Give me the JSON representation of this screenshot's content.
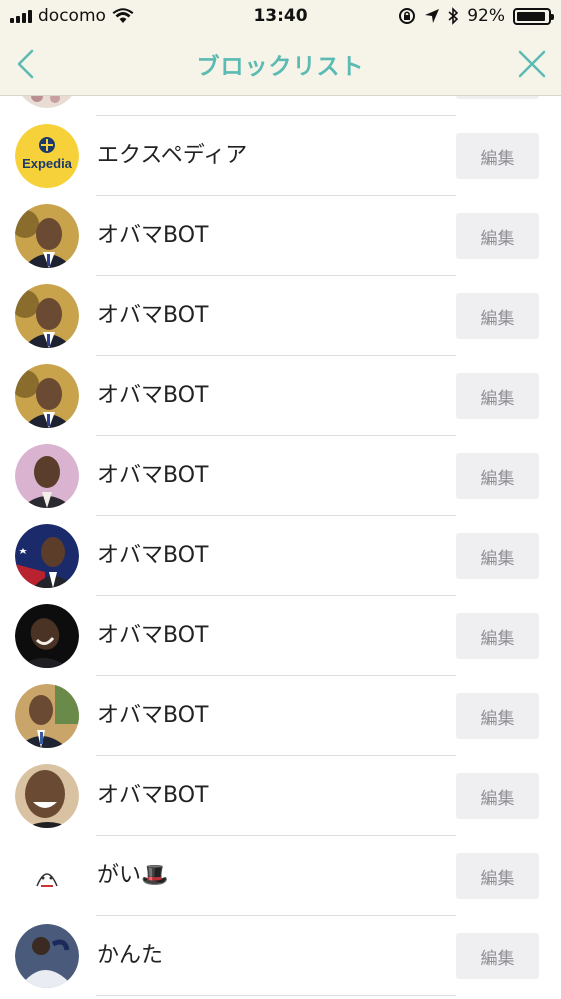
{
  "status_bar": {
    "carrier": "docomo",
    "time": "13:40",
    "battery_percent": "92%",
    "battery_level": 0.92,
    "icons": [
      "signal-icon",
      "wifi-icon",
      "orientation-lock-icon",
      "location-arrow-icon",
      "bluetooth-icon",
      "battery-icon"
    ]
  },
  "nav": {
    "title": "ブロックリスト",
    "back_icon": "chevron-left-icon",
    "close_icon": "close-icon",
    "accent_color": "#5bbbb3"
  },
  "rows": [
    {
      "name": "",
      "edit_label": "",
      "avatar": "partial-avatar"
    },
    {
      "name": "エクスペディア",
      "edit_label": "編集",
      "avatar": "expedia-logo",
      "logo_text": "Expedia"
    },
    {
      "name": "オバマBOT",
      "edit_label": "編集",
      "avatar": "photo-avatar"
    },
    {
      "name": "オバマBOT",
      "edit_label": "編集",
      "avatar": "photo-avatar"
    },
    {
      "name": "オバマBOT",
      "edit_label": "編集",
      "avatar": "photo-avatar"
    },
    {
      "name": "オバマBOT",
      "edit_label": "編集",
      "avatar": "photo-avatar"
    },
    {
      "name": "オバマBOT",
      "edit_label": "編集",
      "avatar": "photo-avatar"
    },
    {
      "name": "オバマBOT",
      "edit_label": "編集",
      "avatar": "photo-avatar"
    },
    {
      "name": "オバマBOT",
      "edit_label": "編集",
      "avatar": "photo-avatar"
    },
    {
      "name": "オバマBOT",
      "edit_label": "編集",
      "avatar": "photo-avatar"
    },
    {
      "name": "がい🎩",
      "edit_label": "編集",
      "avatar": "illustration-avatar"
    },
    {
      "name": "かんた",
      "edit_label": "編集",
      "avatar": "photo-avatar"
    }
  ]
}
